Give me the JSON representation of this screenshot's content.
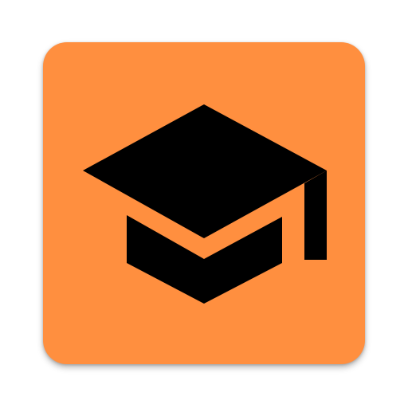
{
  "app_icon": {
    "icon_name": "graduation-cap-icon",
    "background_color": "#FF8F3F",
    "glyph_color": "#000000"
  }
}
